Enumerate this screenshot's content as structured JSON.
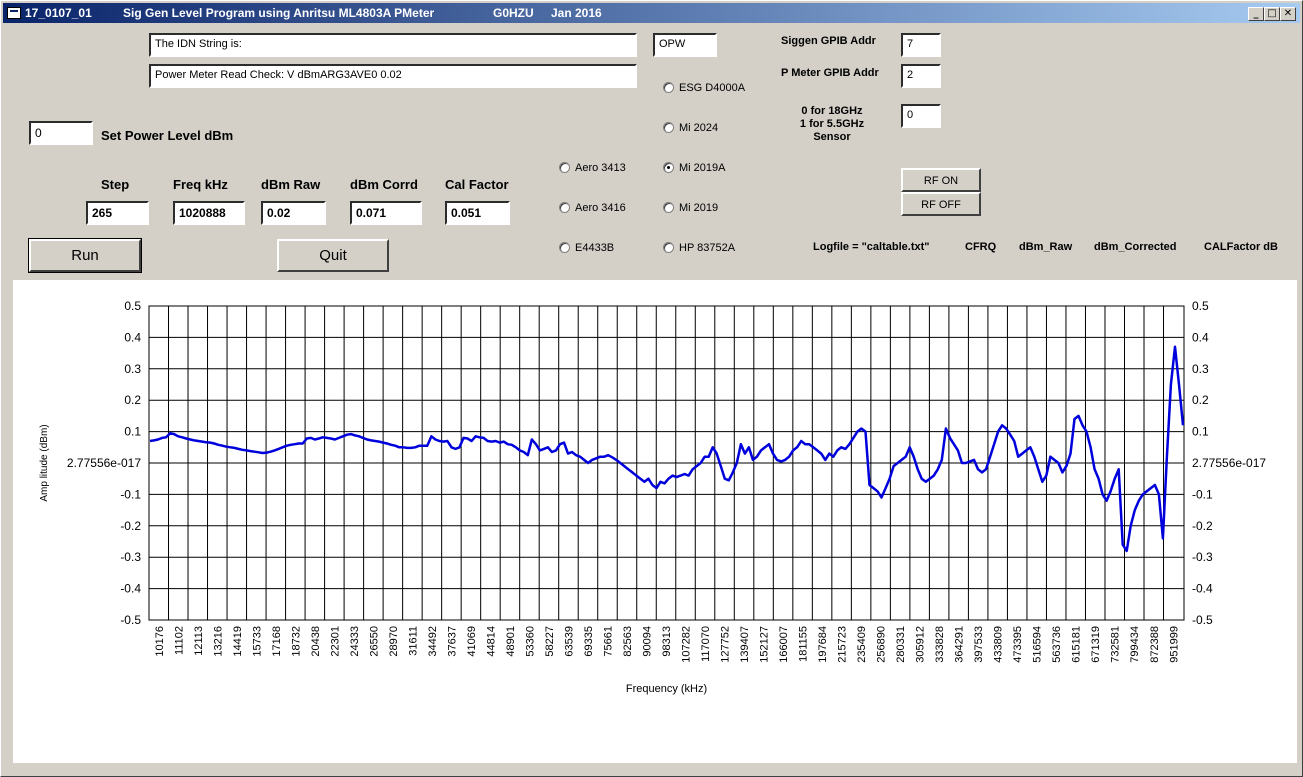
{
  "window": {
    "title_parts": [
      "17_0107_01",
      "Sig Gen Level Program using Anritsu ML4803A PMeter",
      "G0HZU",
      "Jan 2016"
    ],
    "controls": [
      "_",
      "□",
      "✕"
    ]
  },
  "top": {
    "idn_text": "The IDN String is:",
    "read_check_text": "Power Meter Read Check: V dBmARG3AVE0  0.02",
    "opw_value": "OPW"
  },
  "gpib": {
    "siggen_label": "Siggen GPIB Addr",
    "siggen_value": "7",
    "pmeter_label": "P Meter GPIB Addr",
    "pmeter_value": "2",
    "sensor_label_lines": [
      "0 for 18GHz",
      "1 for 5.5GHz",
      "Sensor"
    ],
    "sensor_value": "0"
  },
  "power": {
    "value": "0",
    "label": "Set Power Level dBm"
  },
  "readouts": [
    {
      "label": "Step",
      "value": "265"
    },
    {
      "label": "Freq kHz",
      "value": "1020888"
    },
    {
      "label": "dBm Raw",
      "value": "0.02"
    },
    {
      "label": "dBm Corrd",
      "value": "0.071"
    },
    {
      "label": "Cal Factor",
      "value": "0.051"
    }
  ],
  "generators": {
    "left": [
      "Aero 3413",
      "Aero 3416",
      "E4433B"
    ],
    "right": [
      "ESG D4000A",
      "Mi 2024",
      "Mi 2019A",
      "Mi 2019",
      "HP 83752A"
    ],
    "selected": "Mi 2019A"
  },
  "buttons": {
    "run": "Run",
    "quit": "Quit",
    "rf_on": "RF ON",
    "rf_off": "RF OFF"
  },
  "logfile": {
    "label": "Logfile = \"caltable.txt\"",
    "columns": [
      "CFRQ",
      "dBm_Raw",
      "dBm_Corrected",
      "CALFactor dB"
    ]
  },
  "colors": {
    "face": "#d4d0c8",
    "title_start": "#0a246a",
    "title_end": "#a6caf0",
    "trace": "#0000dd"
  },
  "chart_data": {
    "type": "line",
    "title": "",
    "xlabel": "Frequency (kHz)",
    "ylabel": "Amp litude (dBm)",
    "ylim": [
      -0.5,
      0.5
    ],
    "y_ticks": [
      "0.5",
      "0.4",
      "0.3",
      "0.2",
      "0.1",
      "2.77556e-017",
      "-0.1",
      "-0.2",
      "-0.3",
      "-0.4",
      "-0.5"
    ],
    "x_tick_labels": [
      "10176",
      "11102",
      "12113",
      "13216",
      "14419",
      "15733",
      "17168",
      "18732",
      "20438",
      "22301",
      "24333",
      "26550",
      "28970",
      "31611",
      "34492",
      "37637",
      "41069",
      "44814",
      "48901",
      "53360",
      "58227",
      "63539",
      "69335",
      "75661",
      "82563",
      "90094",
      "98313",
      "107282",
      "117070",
      "127752",
      "139407",
      "152127",
      "166007",
      "181155",
      "197684",
      "215723",
      "235409",
      "256890",
      "280331",
      "305912",
      "333828",
      "364291",
      "397533",
      "433809",
      "473395",
      "516594",
      "563736",
      "615181",
      "671319",
      "732581",
      "799434",
      "872388",
      "951999"
    ],
    "grid": true,
    "series": [
      {
        "name": "",
        "values": [
          0.07,
          0.072,
          0.075,
          0.08,
          0.082,
          0.095,
          0.092,
          0.085,
          0.082,
          0.078,
          0.075,
          0.072,
          0.07,
          0.068,
          0.066,
          0.065,
          0.062,
          0.058,
          0.055,
          0.052,
          0.05,
          0.048,
          0.045,
          0.042,
          0.04,
          0.038,
          0.036,
          0.034,
          0.032,
          0.033,
          0.036,
          0.04,
          0.045,
          0.05,
          0.055,
          0.058,
          0.06,
          0.062,
          0.062,
          0.078,
          0.08,
          0.075,
          0.078,
          0.082,
          0.08,
          0.078,
          0.075,
          0.08,
          0.085,
          0.09,
          0.092,
          0.088,
          0.085,
          0.08,
          0.075,
          0.072,
          0.07,
          0.068,
          0.065,
          0.062,
          0.058,
          0.055,
          0.05,
          0.05,
          0.048,
          0.048,
          0.05,
          0.055,
          0.055,
          0.055,
          0.085,
          0.075,
          0.07,
          0.068,
          0.07,
          0.05,
          0.045,
          0.05,
          0.08,
          0.078,
          0.07,
          0.085,
          0.082,
          0.08,
          0.07,
          0.068,
          0.07,
          0.065,
          0.068,
          0.06,
          0.058,
          0.05,
          0.04,
          0.035,
          0.025,
          0.075,
          0.06,
          0.04,
          0.045,
          0.05,
          0.035,
          0.04,
          0.06,
          0.065,
          0.03,
          0.035,
          0.025,
          0.02,
          0.01,
          0.0,
          0.01,
          0.015,
          0.02,
          0.02,
          0.025,
          0.018,
          0.01,
          0.0,
          -0.01,
          -0.02,
          -0.03,
          -0.04,
          -0.05,
          -0.06,
          -0.05,
          -0.07,
          -0.08,
          -0.06,
          -0.065,
          -0.05,
          -0.04,
          -0.045,
          -0.04,
          -0.035,
          -0.04,
          -0.02,
          -0.01,
          0.0,
          0.02,
          0.02,
          0.05,
          0.03,
          -0.01,
          -0.05,
          -0.055,
          -0.03,
          0.0,
          0.06,
          0.03,
          0.05,
          0.01,
          0.02,
          0.04,
          0.05,
          0.06,
          0.03,
          0.01,
          0.005,
          0.01,
          0.02,
          0.04,
          0.05,
          0.07,
          0.06,
          0.06,
          0.05,
          0.04,
          0.03,
          0.01,
          0.03,
          0.02,
          0.04,
          0.05,
          0.045,
          0.06,
          0.08,
          0.1,
          0.11,
          0.1,
          -0.07,
          -0.08,
          -0.09,
          -0.11,
          -0.08,
          -0.05,
          -0.01,
          0.0,
          0.01,
          0.02,
          0.05,
          0.02,
          -0.02,
          -0.05,
          -0.06,
          -0.05,
          -0.04,
          -0.02,
          0.01,
          0.11,
          0.08,
          0.06,
          0.04,
          0.0,
          0.0,
          0.005,
          0.01,
          -0.02,
          -0.03,
          -0.02,
          0.02,
          0.06,
          0.1,
          0.12,
          0.11,
          0.09,
          0.07,
          0.02,
          0.03,
          0.04,
          0.05,
          0.02,
          -0.02,
          -0.06,
          -0.04,
          0.02,
          0.01,
          0.0,
          -0.03,
          -0.01,
          0.03,
          0.14,
          0.15,
          0.12,
          0.1,
          0.05,
          -0.02,
          -0.05,
          -0.1,
          -0.12,
          -0.09,
          -0.05,
          -0.02,
          -0.26,
          -0.28,
          -0.2,
          -0.15,
          -0.12,
          -0.1,
          -0.09,
          -0.08,
          -0.07,
          -0.1,
          -0.24,
          0.02,
          0.25,
          0.37,
          0.25,
          0.12
        ]
      }
    ]
  }
}
